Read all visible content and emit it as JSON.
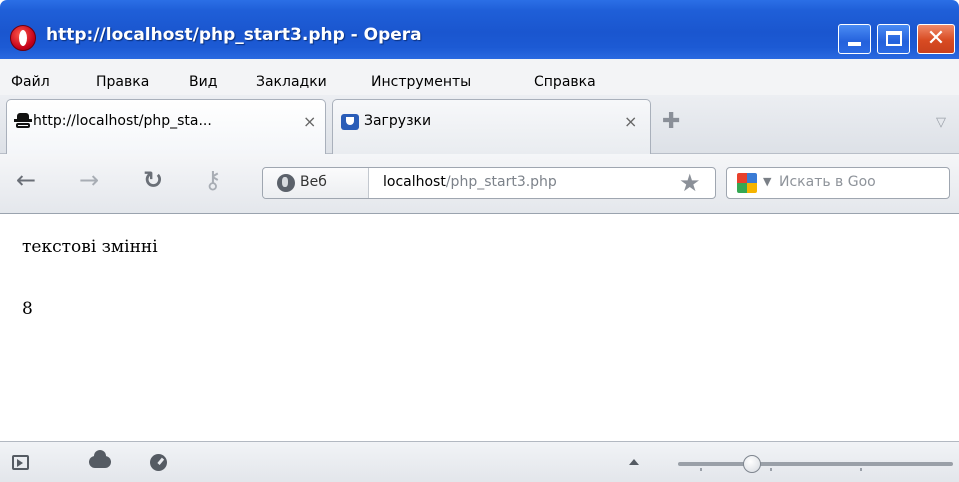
{
  "window": {
    "title": "http://localhost/php_start3.php - Opera",
    "controls": {
      "minimize_icon": "minimize-icon",
      "maximize_icon": "maximize-icon",
      "close_glyph": "✕"
    },
    "accent_colors": {
      "titlebar": "#1f5fd8",
      "close_button": "#d84b22"
    }
  },
  "menu": {
    "items": [
      "Файл",
      "Правка",
      "Вид",
      "Закладки",
      "Инструменты",
      "Справка"
    ]
  },
  "tabs": {
    "items": [
      {
        "label": "http://localhost/php_sta...",
        "close": "×",
        "icon": "spy-icon",
        "active": true
      },
      {
        "label": "Загрузки",
        "close": "×",
        "icon": "downloads-icon",
        "active": false
      }
    ],
    "new_tab_glyph": "✚",
    "tabs_menu_glyph": "▽"
  },
  "navigation": {
    "back_glyph": "←",
    "forward_glyph": "→",
    "reload_glyph": "↻",
    "key_glyph": "⚷",
    "security_label": "Веб",
    "url_host": "localhost",
    "url_path": "/php_start3.php",
    "bookmark_glyph": "★",
    "search_placeholder": "Искать в Goo",
    "search_dropdown_glyph": "▼"
  },
  "page": {
    "lines": [
      "текстові змінні",
      "8"
    ]
  },
  "statusbar": {
    "zoom_level": 0.27
  }
}
